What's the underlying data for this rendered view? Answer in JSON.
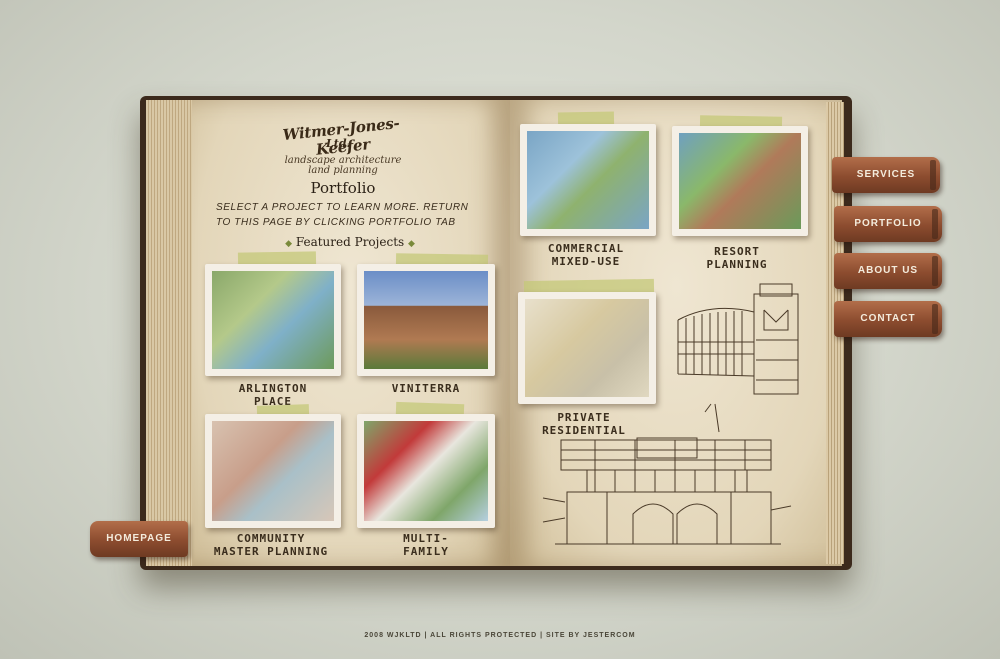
{
  "logo": {
    "name": "Witmer-Jones-Keefer",
    "ltd": "Ltd.",
    "tagline_1": "landscape architecture",
    "tagline_2": "land planning"
  },
  "page_title": "Portfolio",
  "instructions": "SELECT A PROJECT TO LEARN MORE. RETURN TO THIS PAGE BY CLICKING PORTFOLIO TAB",
  "featured_heading": "Featured Projects",
  "projects": [
    {
      "line1": "ARLINGTON",
      "line2": "PLACE"
    },
    {
      "line1": "VINITERRA",
      "line2": ""
    },
    {
      "line1": "COMMUNITY",
      "line2": "MASTER PLANNING"
    },
    {
      "line1": "MULTI-",
      "line2": "FAMILY"
    },
    {
      "line1": "COMMERCIAL",
      "line2": "MIXED-USE"
    },
    {
      "line1": "RESORT",
      "line2": "PLANNING"
    },
    {
      "line1": "PRIVATE",
      "line2": "RESIDENTIAL"
    }
  ],
  "nav": {
    "services": "SERVICES",
    "portfolio": "PORTFOLIO",
    "about": "ABOUT US",
    "contact": "CONTACT",
    "homepage": "HOMEPAGE"
  },
  "footer": "2008 WJKLTD  |  ALL RIGHTS PROTECTED  |  SITE BY JESTERCOM"
}
